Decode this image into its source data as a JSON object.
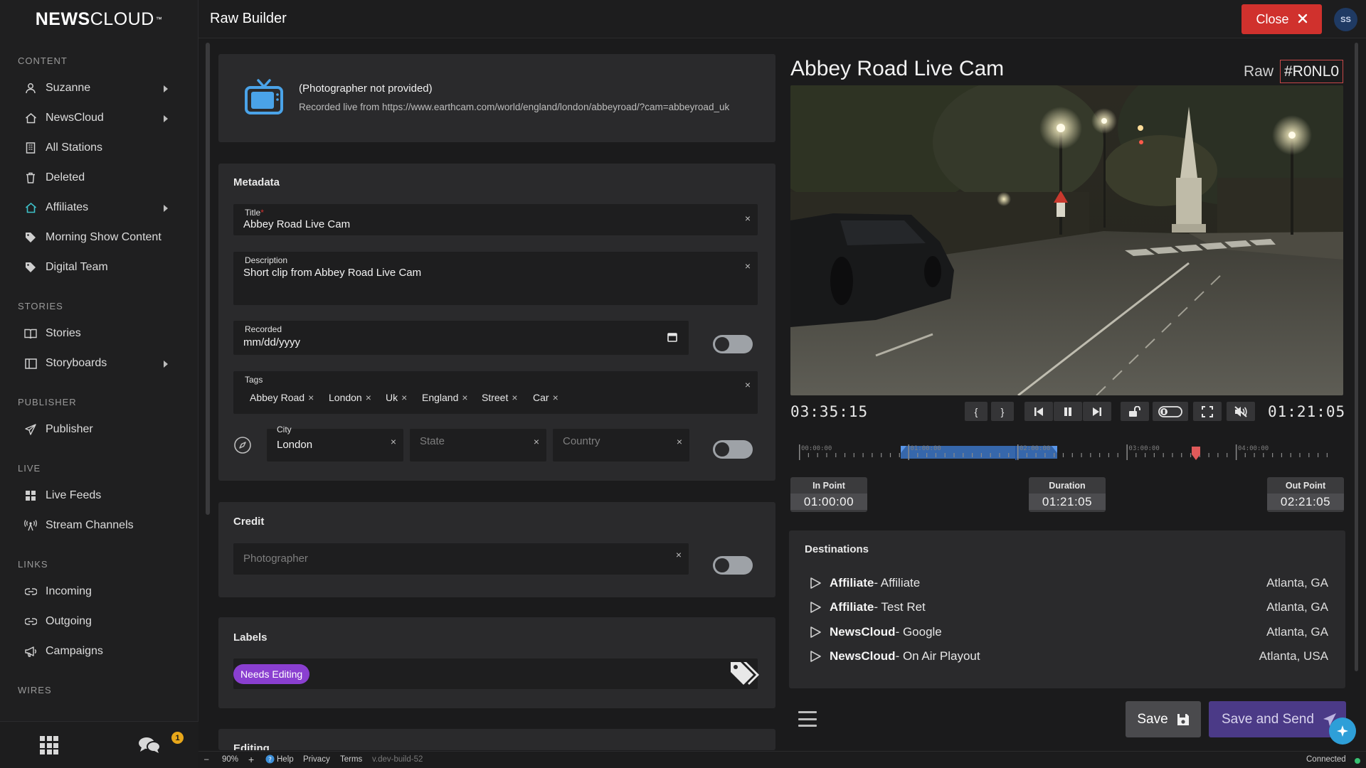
{
  "app": {
    "logo_bold": "NEWS",
    "logo_light": "CLOUD",
    "logo_tm": "™",
    "page_title": "Raw Builder",
    "close_label": "Close",
    "avatar_initials": "SS"
  },
  "sidebar": {
    "sections": {
      "content": "CONTENT",
      "stories": "STORIES",
      "publisher": "PUBLISHER",
      "live": "LIVE",
      "links": "LINKS",
      "wires": "WIRES"
    },
    "items": {
      "suzanne": "Suzanne",
      "newscloud": "NewsCloud",
      "all_stations": "All Stations",
      "deleted": "Deleted",
      "affiliates": "Affiliates",
      "morning_show": "Morning Show Content",
      "digital_team": "Digital Team",
      "stories": "Stories",
      "storyboards": "Storyboards",
      "publisher": "Publisher",
      "live_feeds": "Live Feeds",
      "stream_channels": "Stream Channels",
      "incoming": "Incoming",
      "outgoing": "Outgoing",
      "campaigns": "Campaigns"
    },
    "chat_badge": "1"
  },
  "source": {
    "photographer": "(Photographer not provided)",
    "recorded_from": "Recorded live from https://www.earthcam.com/world/england/london/abbeyroad/?cam=abbeyroad_uk"
  },
  "metadata": {
    "heading": "Metadata",
    "title_label": "Title",
    "title_required": "*",
    "title_value": "Abbey Road Live Cam",
    "description_label": "Description",
    "description_value": "Short clip from Abbey Road Live Cam",
    "recorded_label": "Recorded",
    "recorded_placeholder": "mm/dd/yyyy",
    "tags_label": "Tags",
    "tags": [
      "Abbey Road",
      "London",
      "Uk",
      "England",
      "Street",
      "Car"
    ],
    "city_label": "City",
    "city_value": "London",
    "state_placeholder": "State",
    "country_placeholder": "Country",
    "clear_glyph": "×"
  },
  "credit": {
    "heading": "Credit",
    "photographer_placeholder": "Photographer"
  },
  "labels": {
    "heading": "Labels",
    "items": [
      "Needs Editing"
    ],
    "pill_color": "#8a3fd0"
  },
  "editing": {
    "heading": "Editing"
  },
  "player": {
    "title": "Abbey Road Live Cam",
    "raw_label": "Raw",
    "raw_id": "#R0NL0",
    "current_time": "03:35:15",
    "clip_time": "01:21:05",
    "timeline_ticks": [
      "00:00:00",
      "01:00:00",
      "02:00:00",
      "03:00:00",
      "04:00:00"
    ],
    "in_point_label": "In Point",
    "in_point_value": "01:00:00",
    "duration_label": "Duration",
    "duration_value": "01:21:05",
    "out_point_label": "Out Point",
    "out_point_value": "02:21:05"
  },
  "destinations": {
    "heading": "Destinations",
    "rows": [
      {
        "org": "Affiliate",
        "name": "- Affiliate",
        "location": "Atlanta, GA"
      },
      {
        "org": "Affiliate",
        "name": "- Test Ret",
        "location": "Atlanta, GA"
      },
      {
        "org": "NewsCloud",
        "name": "- Google",
        "location": "Atlanta, GA"
      },
      {
        "org": "NewsCloud",
        "name": "- On Air Playout",
        "location": "Atlanta, USA"
      }
    ]
  },
  "actions": {
    "save_label": "Save",
    "save_send_label": "Save and Send"
  },
  "footer": {
    "zoom": "90%",
    "minus": "–",
    "plus": "+",
    "help": "Help",
    "privacy": "Privacy",
    "terms": "Terms",
    "version": "v.dev-build-52",
    "status": "Connected"
  },
  "colors": {
    "accent_red": "#d0312d",
    "accent_purple": "#4b3a87",
    "accent_teal": "#3ec1c9",
    "timeline_blue": "#3e7fd6",
    "playhead_red": "#e05a5a",
    "connected_green": "#38c172"
  }
}
